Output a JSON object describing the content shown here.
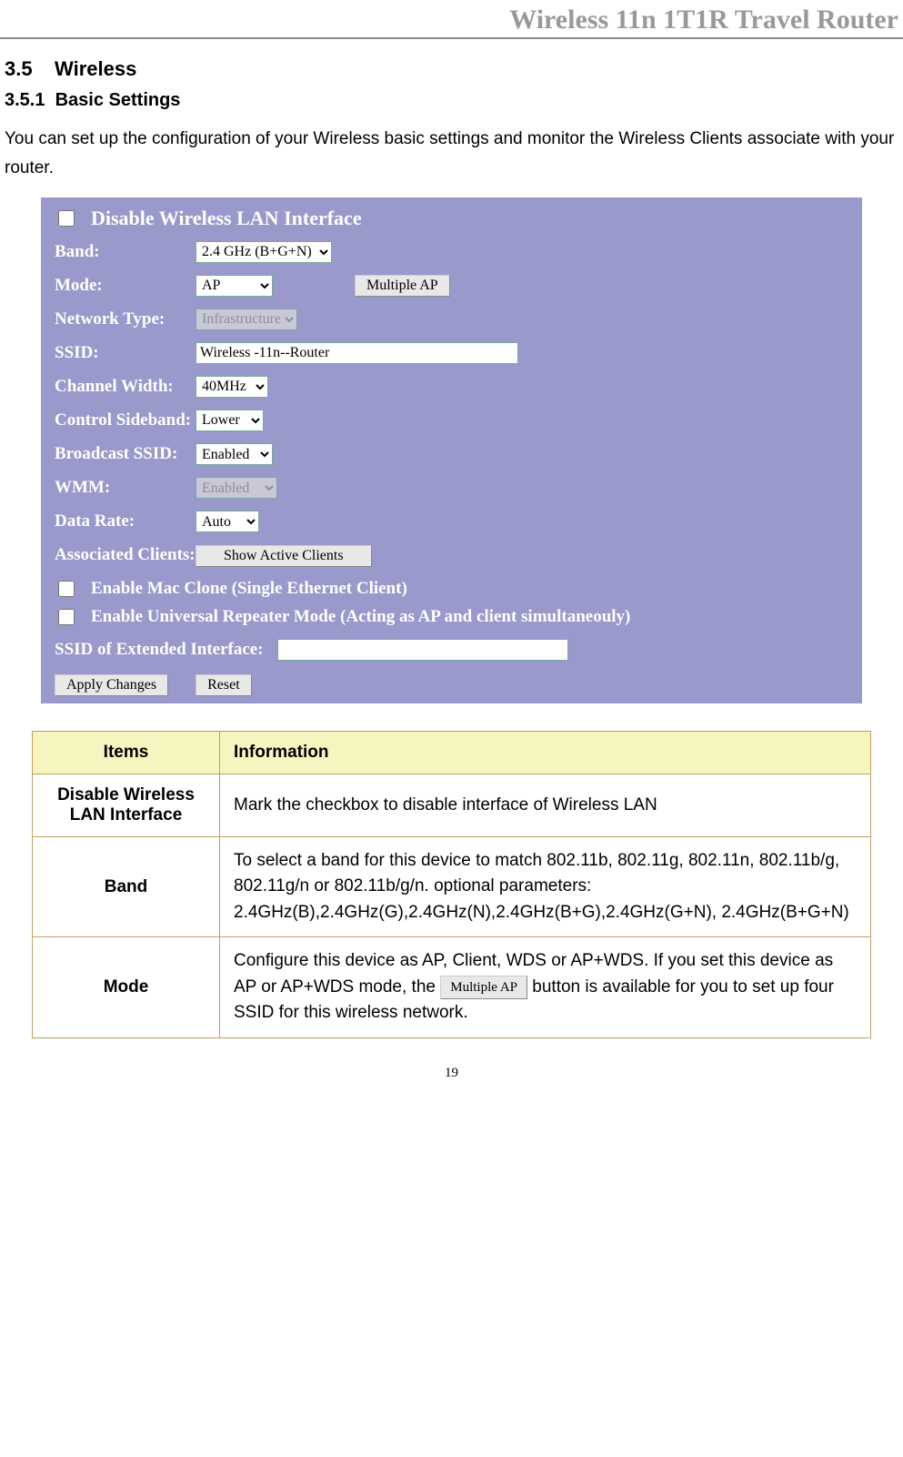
{
  "header": {
    "title": "Wireless 11n 1T1R Travel Router"
  },
  "section": {
    "num": "3.5",
    "title": "Wireless",
    "sub_num": "3.5.1",
    "sub_title": "Basic Settings",
    "intro": "You can set up the configuration of your Wireless basic settings and monitor the Wireless Clients associate with your router."
  },
  "ui": {
    "disable_label": "Disable Wireless LAN Interface",
    "band_label": "Band:",
    "band_value": "2.4 GHz (B+G+N)",
    "mode_label": "Mode:",
    "mode_value": "AP",
    "multiple_ap_btn": "Multiple AP",
    "network_type_label": "Network Type:",
    "network_type_value": "Infrastructure",
    "ssid_label": "SSID:",
    "ssid_value": "Wireless -11n--Router",
    "channel_width_label": "Channel Width:",
    "channel_width_value": "40MHz",
    "control_sideband_label": "Control Sideband:",
    "control_sideband_value": "Lower",
    "broadcast_ssid_label": "Broadcast SSID:",
    "broadcast_ssid_value": "Enabled",
    "wmm_label": "WMM:",
    "wmm_value": "Enabled",
    "data_rate_label": "Data Rate:",
    "data_rate_value": "Auto",
    "associated_clients_label": "Associated Clients:",
    "show_active_btn": "Show Active Clients",
    "mac_clone_label": "Enable Mac Clone (Single Ethernet Client)",
    "universal_repeater_label": "Enable Universal Repeater Mode (Acting as AP and client simultaneouly)",
    "extended_ssid_label": "SSID of Extended Interface:",
    "extended_ssid_value": "",
    "apply_btn": "Apply Changes",
    "reset_btn": "Reset"
  },
  "table": {
    "header_items": "Items",
    "header_info": "Information",
    "rows": [
      {
        "item": "Disable Wireless LAN Interface",
        "info": "Mark the checkbox to disable interface of Wireless LAN"
      },
      {
        "item": "Band",
        "info": "To select a band for this device to match 802.11b, 802.11g, 802.11n, 802.11b/g, 802.11g/n or 802.11b/g/n. optional parameters: 2.4GHz(B),2.4GHz(G),2.4GHz(N),2.4GHz(B+G),2.4GHz(G+N), 2.4GHz(B+G+N)"
      },
      {
        "item": "Mode",
        "info_before": "Configure this device as AP, Client, WDS or AP+WDS. If you set this device as AP or AP+WDS mode, the ",
        "info_btn": "Multiple AP",
        "info_after": " button is available for you to set up four SSID for this wireless network."
      }
    ]
  },
  "page_num": "19"
}
